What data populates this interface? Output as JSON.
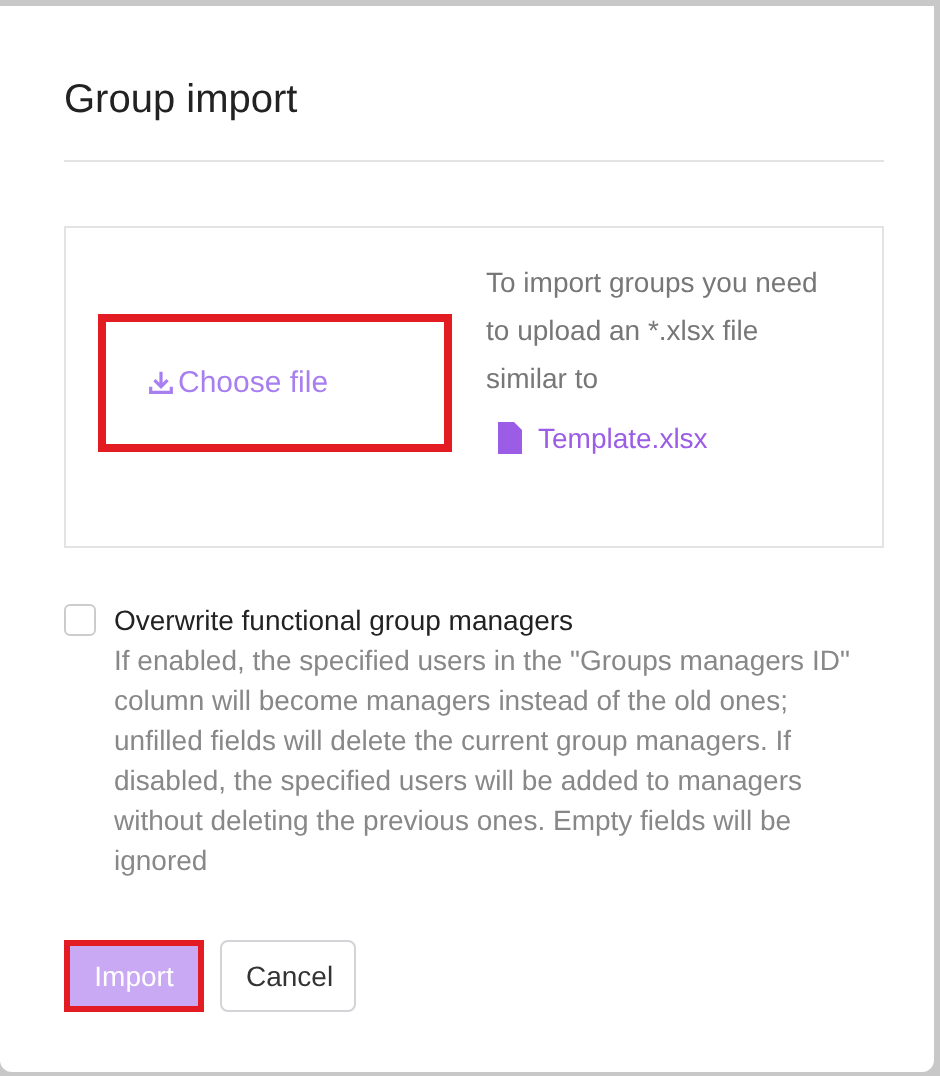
{
  "dialog": {
    "title": "Group import"
  },
  "upload": {
    "choose_file": {
      "label": "Choose file",
      "highlighted": true
    },
    "hint": "To import groups you need to upload an *.xlsx file similar to",
    "template_link": "Template.xlsx"
  },
  "option": {
    "label": "Overwrite functional group managers",
    "checked": false,
    "description": "If enabled, the specified users in the \"Groups managers ID\" column will become managers instead of the old ones; unfilled fields will delete the current group managers. If disabled, the specified users will be added to managers without deleting the previous ones. Empty fields will be ignored"
  },
  "buttons": [
    {
      "label": "Import",
      "kind": "primary",
      "disabled": true,
      "highlighted": true
    },
    {
      "label": "Cancel",
      "kind": "secondary",
      "disabled": false,
      "highlighted": false
    }
  ]
}
